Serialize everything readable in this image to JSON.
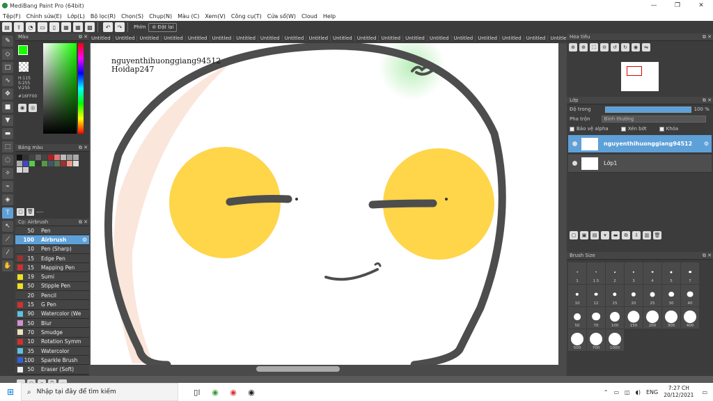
{
  "window": {
    "title": "MediBang Paint Pro (64bit)"
  },
  "menu": [
    "Tệp(F)",
    "Chỉnh sửa(E)",
    "Lớp(L)",
    "Bộ lọc(R)",
    "Chọn(S)",
    "Chụp(N)",
    "Màu (C)",
    "Xem(V)",
    "Công cụ(T)",
    "Cửa sổ(W)",
    "Cloud",
    "Help"
  ],
  "toolbar": {
    "phim_label": "Phím",
    "dat_lai_label": "Đặt lại"
  },
  "color_panel": {
    "title": "Màu",
    "h": "H:115",
    "s": "S:255",
    "v": "V:255",
    "hex": "#16FF00",
    "fg_color": "#16FF00"
  },
  "palette": {
    "title": "Bảng màu",
    "footer_text": "----",
    "colors": [
      "#111111",
      "#333333",
      "#444444",
      "#666666",
      "#444444",
      "#aa2222",
      "#dd7777",
      "#bbbbbb",
      "#999999",
      "#aaaaaa",
      "#aaaaaa",
      "#4444cc",
      "#55cc44",
      "#333333",
      "#559944",
      "#445566",
      "#557755",
      "#993333",
      "#ee9988",
      "#dddddd",
      "#dddddd",
      "#cccccc"
    ]
  },
  "brush_panel": {
    "title": "Cọ: Airbrush",
    "items": [
      {
        "size": "50",
        "name": "Pen",
        "color": "#444444"
      },
      {
        "size": "100",
        "name": "Airbrush",
        "color": "#5ea0d8"
      },
      {
        "size": "10",
        "name": "Pen (Sharp)",
        "color": "#444444"
      },
      {
        "size": "15",
        "name": "Edge Pen",
        "color": "#a03030"
      },
      {
        "size": "15",
        "name": "Mapping Pen",
        "color": "#d03030"
      },
      {
        "size": "19",
        "name": "Sumi",
        "color": "#f0e020"
      },
      {
        "size": "50",
        "name": "Stipple Pen",
        "color": "#f0e020"
      },
      {
        "size": "20",
        "name": "Pencil",
        "color": "#444444"
      },
      {
        "size": "15",
        "name": "G Pen",
        "color": "#d03030"
      },
      {
        "size": "90",
        "name": "Watercolor (We",
        "color": "#60c0e0"
      },
      {
        "size": "50",
        "name": "Blur",
        "color": "#d090d0"
      },
      {
        "size": "70",
        "name": "Smudge",
        "color": "#f0e0c0"
      },
      {
        "size": "10",
        "name": "Rotation Symm",
        "color": "#d03030"
      },
      {
        "size": "35",
        "name": "Watercolor",
        "color": "#60c0e0"
      },
      {
        "size": "100",
        "name": "Sparkle Brush",
        "color": "#3060e0"
      },
      {
        "size": "50",
        "name": "Eraser (Soft)",
        "color": "#eeeeee"
      }
    ]
  },
  "tabs": [
    "Untitled",
    "Untitled",
    "Untitled",
    "Untitled",
    "Untitled",
    "Untitled",
    "Untitled",
    "Untitled",
    "Untitled",
    "Untitled",
    "Untitled",
    "Untitled",
    "Untitled",
    "Untitled",
    "Untitled",
    "Untitled",
    "Untitled",
    "Untitled",
    "Untitled",
    "Untitled",
    "Untitled",
    "Untitled",
    "Untitled",
    "Untitled"
  ],
  "canvas": {
    "watermark_line1": "nguyenthihuonggiang94512",
    "watermark_line2": "Hoidap247"
  },
  "navigator": {
    "title": "Hoa tiêu"
  },
  "layers": {
    "title": "Lớp",
    "opacity_label": "Độ trong",
    "opacity_value": "100 %",
    "opacity_fraction": 1.0,
    "blend_label": "Pha trộn",
    "blend_value": "Bình thường",
    "alpha_label": "Bảo vệ alpha",
    "clip_label": "Xén bớt",
    "lock_label": "Khóa",
    "items": [
      {
        "name": "nguyenthihuonggiang94512",
        "selected": true
      },
      {
        "name": "Lớp1",
        "selected": false
      }
    ]
  },
  "brush_size": {
    "title": "Brush Size",
    "sizes": [
      "1",
      "1.5",
      "2",
      "3",
      "4",
      "5",
      "7",
      "10",
      "12",
      "15",
      "20",
      "25",
      "30",
      "40",
      "50",
      "70",
      "100",
      "150",
      "200",
      "300",
      "400",
      "500",
      "700",
      "1000"
    ]
  },
  "taskbar": {
    "search_placeholder": "Nhập tại đây để tìm kiếm",
    "lang": "ENG",
    "time": "7:27 CH",
    "date": "20/12/2021"
  }
}
